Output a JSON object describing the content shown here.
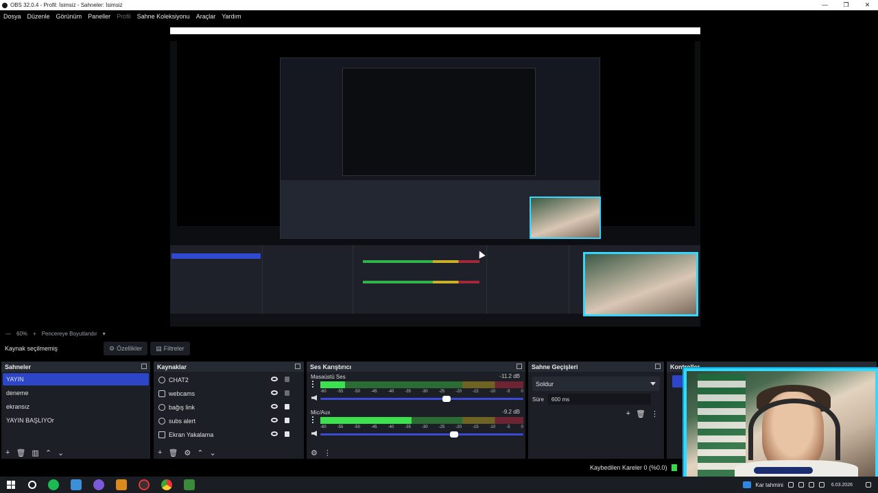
{
  "window": {
    "title": "OBS 32.0.4 - Profil: İsimsiz - Sahneler: İsimsiz",
    "minimize": "—",
    "restore": "❐",
    "close": "✕"
  },
  "menu": [
    "Dosya",
    "Düzenle",
    "Görünüm",
    "Paneller",
    "Profil",
    "Sahne Koleksiyonu",
    "Araçlar",
    "Yardım"
  ],
  "zoom_row": {
    "zoom": "60%",
    "fit": "Pencereye Boyutlandır"
  },
  "source_toolbar": {
    "no_source": "Kaynak seçilmemiş",
    "properties": "Özellikler",
    "filters": "Filtreler"
  },
  "scenes": {
    "title": "Sahneler",
    "items": [
      "YAYIN",
      "deneme",
      "ekransız",
      "YAYIN BAŞLIYOr"
    ],
    "active_index": 0
  },
  "sources": {
    "title": "Kaynaklar",
    "items": [
      {
        "label": "CHAT2",
        "icon": "browser-icon",
        "locked": false
      },
      {
        "label": "webcams",
        "icon": "camera-icon",
        "locked": false
      },
      {
        "label": "bağış link",
        "icon": "browser-icon",
        "locked": true
      },
      {
        "label": "subs alert",
        "icon": "browser-icon",
        "locked": true
      },
      {
        "label": "Ekran Yakalama",
        "icon": "monitor-icon",
        "locked": true
      }
    ]
  },
  "mixer": {
    "title": "Ses Karıştırıcı",
    "scale": [
      "-60",
      "-55",
      "-50",
      "-45",
      "-40",
      "-35",
      "-30",
      "-25",
      "-20",
      "-15",
      "-10",
      "-5",
      "0"
    ],
    "channels": [
      {
        "name": "Masaüstü Ses",
        "db": "-11.2 dB",
        "level": 0.12,
        "volume": 0.62
      },
      {
        "name": "Mic/Aux",
        "db": "-9.2 dB",
        "level": 0.45,
        "volume": 0.66
      }
    ]
  },
  "transitions": {
    "title": "Sahne Geçişleri",
    "selected": "Soldur",
    "duration_label": "Süre",
    "duration_value": "600 ms"
  },
  "controls": {
    "title": "Kontroller"
  },
  "status": {
    "dropped_frames": "Kaybedilen Kareler 0 (%0.0)"
  },
  "taskbar": {
    "weather": "Kar tahmini",
    "date": "6.03.2026"
  },
  "colors": {
    "accent": "#2c46c7",
    "webcam_border": "#37d8ff",
    "meter_green": "#3be14f"
  }
}
